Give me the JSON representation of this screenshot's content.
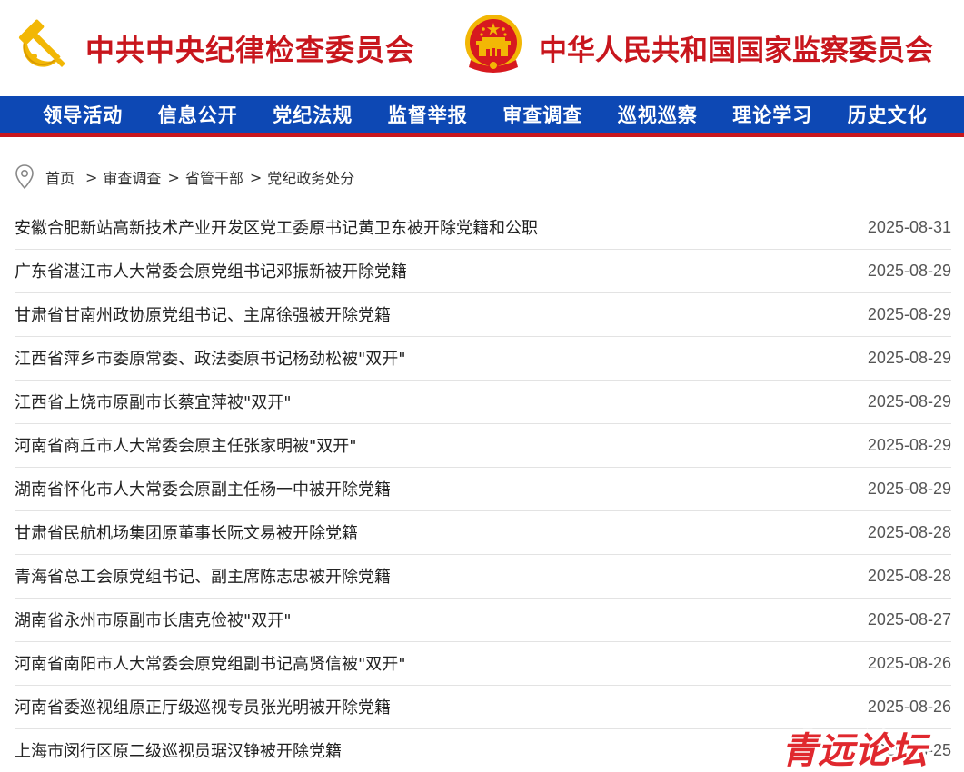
{
  "header": {
    "title_left": "中共中央纪律检查委员会",
    "title_right": "中华人民共和国国家监察委员会",
    "logo_party_icon": "hammer-sickle-icon",
    "emblem_icon": "national-emblem-icon",
    "accent_red": "#c8161d",
    "gold": "#f2b705"
  },
  "nav": {
    "background": "#0d48b4",
    "items": [
      {
        "label": "领导活动"
      },
      {
        "label": "信息公开"
      },
      {
        "label": "党纪法规"
      },
      {
        "label": "监督举报"
      },
      {
        "label": "审查调查"
      },
      {
        "label": "巡视巡察"
      },
      {
        "label": "理论学习"
      },
      {
        "label": "历史文化"
      }
    ]
  },
  "breadcrumb": {
    "icon": "location-pin-icon",
    "items": [
      "首页",
      "审查调查",
      "省管干部",
      "党纪政务处分"
    ],
    "separator": ">"
  },
  "articles": [
    {
      "title": "安徽合肥新站高新技术产业开发区党工委原书记黄卫东被开除党籍和公职",
      "date": "2025-08-31"
    },
    {
      "title": "广东省湛江市人大常委会原党组书记邓振新被开除党籍",
      "date": "2025-08-29"
    },
    {
      "title": "甘肃省甘南州政协原党组书记、主席徐强被开除党籍",
      "date": "2025-08-29"
    },
    {
      "title": "江西省萍乡市委原常委、政法委原书记杨劲松被\"双开\"",
      "date": "2025-08-29"
    },
    {
      "title": "江西省上饶市原副市长蔡宜萍被\"双开\"",
      "date": "2025-08-29"
    },
    {
      "title": "河南省商丘市人大常委会原主任张家明被\"双开\"",
      "date": "2025-08-29"
    },
    {
      "title": "湖南省怀化市人大常委会原副主任杨一中被开除党籍",
      "date": "2025-08-29"
    },
    {
      "title": "甘肃省民航机场集团原董事长阮文易被开除党籍",
      "date": "2025-08-28"
    },
    {
      "title": "青海省总工会原党组书记、副主席陈志忠被开除党籍",
      "date": "2025-08-28"
    },
    {
      "title": "湖南省永州市原副市长唐克俭被\"双开\"",
      "date": "2025-08-27"
    },
    {
      "title": "河南省南阳市人大常委会原党组副书记高贤信被\"双开\"",
      "date": "2025-08-26"
    },
    {
      "title": "河南省委巡视组原正厅级巡视专员张光明被开除党籍",
      "date": "2025-08-26"
    },
    {
      "title": "上海市闵行区原二级巡视员琚汉铮被开除党籍",
      "date": "2025-08-25"
    }
  ],
  "watermark": {
    "text": "青远论坛",
    "color": "#e0282e"
  }
}
